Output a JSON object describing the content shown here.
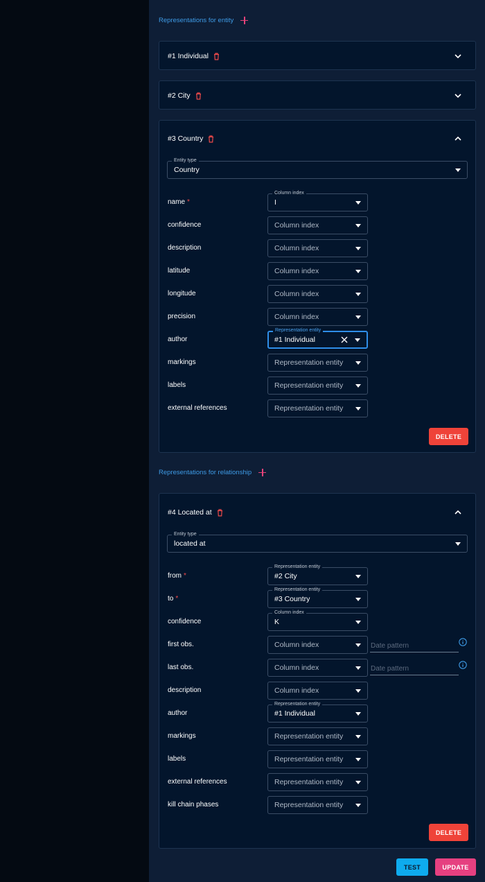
{
  "entity_section": {
    "title": "Representations for entity"
  },
  "relationship_section": {
    "title": "Representations for relationship"
  },
  "collapsed_cards": [
    {
      "title": "#1 Individual"
    },
    {
      "title": "#2 City"
    }
  ],
  "country_card": {
    "title": "#3 Country",
    "entity_type_label": "Entity type",
    "entity_type_value": "Country",
    "fields": [
      {
        "label": "name",
        "required": true,
        "float_label": "Column index",
        "value": "I"
      },
      {
        "label": "confidence",
        "value": "Column index",
        "placeholder": true
      },
      {
        "label": "description",
        "value": "Column index",
        "placeholder": true
      },
      {
        "label": "latitude",
        "value": "Column index",
        "placeholder": true
      },
      {
        "label": "longitude",
        "value": "Column index",
        "placeholder": true
      },
      {
        "label": "precision",
        "value": "Column index",
        "placeholder": true
      },
      {
        "label": "author",
        "float_label": "Representation entity",
        "value": "#1 Individual",
        "focused": true
      },
      {
        "label": "markings",
        "value": "Representation entity",
        "placeholder": true
      },
      {
        "label": "labels",
        "value": "Representation entity",
        "placeholder": true
      },
      {
        "label": "external references",
        "value": "Representation entity",
        "placeholder": true
      }
    ],
    "delete_label": "DELETE"
  },
  "relationship_card": {
    "title": "#4 Located at",
    "entity_type_label": "Entity type",
    "entity_type_value": "located at",
    "fields": [
      {
        "label": "from",
        "required": true,
        "float_label": "Representation entity",
        "value": "#2 City"
      },
      {
        "label": "to",
        "required": true,
        "float_label": "Representation entity",
        "value": "#3 Country"
      },
      {
        "label": "confidence",
        "float_label": "Column index",
        "value": "K"
      },
      {
        "label": "first obs.",
        "value": "Column index",
        "placeholder": true,
        "date_pattern": "Date pattern"
      },
      {
        "label": "last obs.",
        "value": "Column index",
        "placeholder": true,
        "date_pattern": "Date pattern"
      },
      {
        "label": "description",
        "value": "Column index",
        "placeholder": true
      },
      {
        "label": "author",
        "float_label": "Representation entity",
        "value": "#1 Individual"
      },
      {
        "label": "markings",
        "value": "Representation entity",
        "placeholder": true
      },
      {
        "label": "labels",
        "value": "Representation entity",
        "placeholder": true
      },
      {
        "label": "external references",
        "value": "Representation entity",
        "placeholder": true
      },
      {
        "label": "kill chain phases",
        "value": "Representation entity",
        "placeholder": true
      }
    ],
    "delete_label": "DELETE"
  },
  "footer": {
    "test_label": "TEST",
    "update_label": "UPDATE"
  },
  "colors": {
    "accent_blue": "#3e9be6",
    "danger": "#ef4339",
    "pink": "#e64080",
    "cyan": "#0eabee"
  }
}
